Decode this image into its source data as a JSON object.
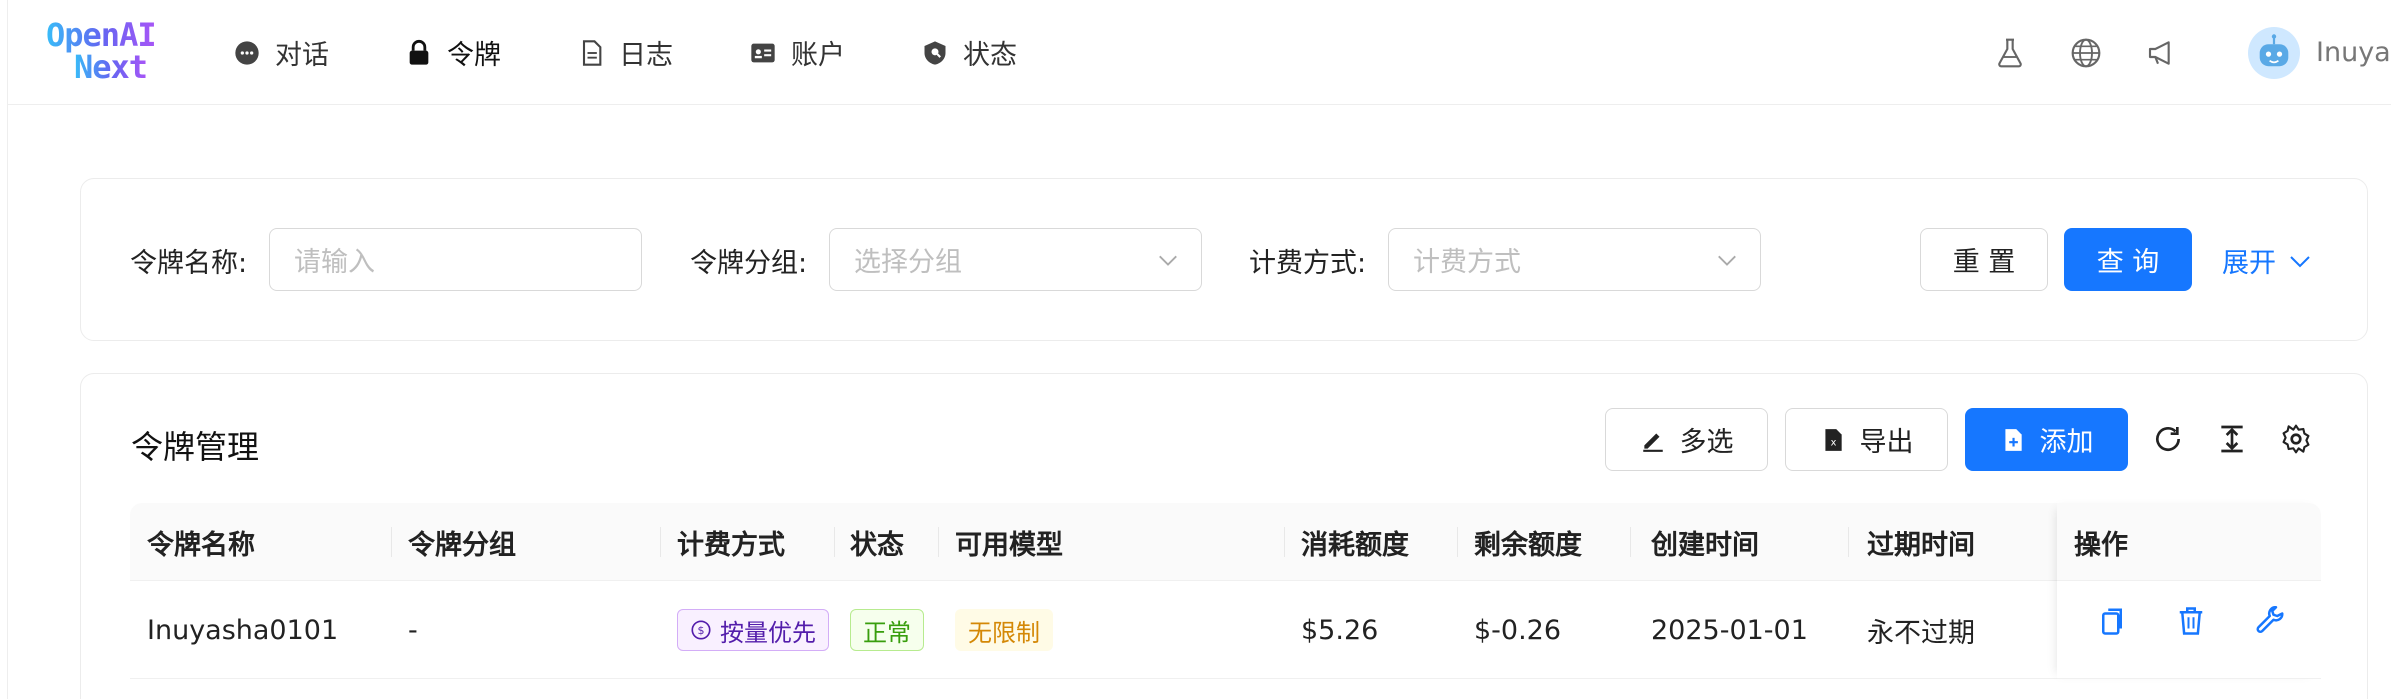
{
  "header": {
    "logo_line1": "OpenAI",
    "logo_line2": "Next",
    "nav": [
      {
        "label": "对话",
        "icon": "chat-bubble-icon"
      },
      {
        "label": "令牌",
        "icon": "lock-icon"
      },
      {
        "label": "日志",
        "icon": "document-icon"
      },
      {
        "label": "账户",
        "icon": "id-card-icon"
      },
      {
        "label": "状态",
        "icon": "shield-icon"
      }
    ],
    "right_icons": [
      "flask-icon",
      "globe-icon",
      "megaphone-icon"
    ],
    "username": "Inuyasha"
  },
  "filters": {
    "token_name_label": "令牌名称:",
    "token_name_placeholder": "请输入",
    "token_group_label": "令牌分组:",
    "token_group_placeholder": "选择分组",
    "billing_label": "计费方式:",
    "billing_placeholder": "计费方式",
    "reset_label": "重 置",
    "query_label": "查 询",
    "expand_label": "展开"
  },
  "table_card": {
    "title": "令牌管理",
    "multi_select_label": "多选",
    "export_label": "导出",
    "add_label": "添加",
    "columns": [
      "令牌名称",
      "令牌分组",
      "计费方式",
      "状态",
      "可用模型",
      "消耗额度",
      "剩余额度",
      "创建时间",
      "过期时间",
      "操作"
    ],
    "rows": [
      {
        "name": "Inuyasha0101",
        "group": "-",
        "billing": "按量优先",
        "status": "正常",
        "models": "无限制",
        "consumed": "$5.26",
        "remaining": "$-0.26",
        "created": "2025-01-01",
        "expires": "永不过期"
      }
    ]
  },
  "colors": {
    "primary": "#1677ff",
    "tag_purple": "#531dab",
    "tag_green": "#389e0d",
    "tag_gold": "#d48806"
  }
}
